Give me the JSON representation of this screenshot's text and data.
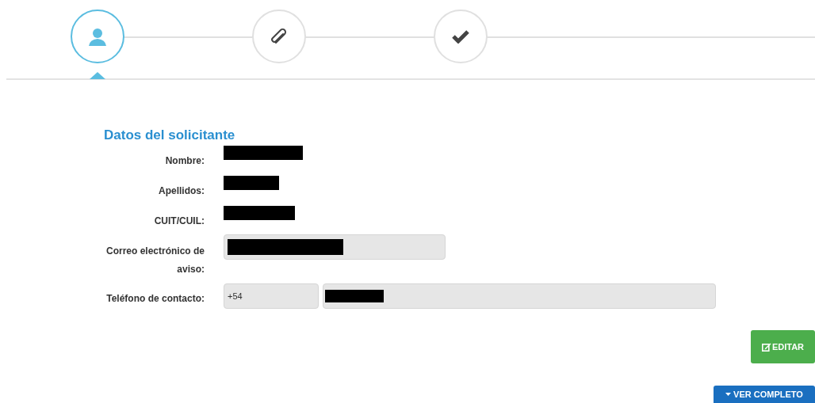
{
  "steps": [
    {
      "kind": "person",
      "selected": true
    },
    {
      "kind": "attachment",
      "selected": false
    },
    {
      "kind": "check",
      "selected": false
    }
  ],
  "section": {
    "title": "Datos del solicitante",
    "rows": [
      {
        "label": "Nombre:",
        "kind": "redacted"
      },
      {
        "label": "Apellidos:",
        "kind": "redacted"
      },
      {
        "label": "CUIT/CUIL:",
        "kind": "redacted"
      },
      {
        "label": "Correo electrónico de aviso:",
        "kind": "field"
      },
      {
        "label": "Teléfono de contacto:",
        "kind": "phone",
        "prefix": "+54"
      }
    ]
  },
  "buttons": [
    {
      "kind": "edit",
      "label": "EDITAR"
    },
    {
      "kind": "expand",
      "label": "VER COMPLETO"
    }
  ]
}
